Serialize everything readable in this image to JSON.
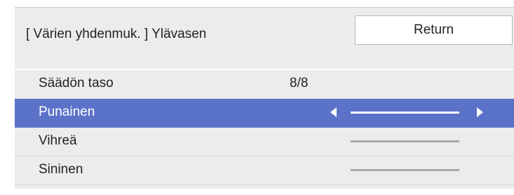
{
  "header": {
    "title": "[ Värien yhdenmuk. ] Ylävasen",
    "return_label": "Return"
  },
  "rows": [
    {
      "label": "Säädön taso",
      "value": "8/8"
    },
    {
      "label": "Punainen",
      "selected": true
    },
    {
      "label": "Vihreä"
    },
    {
      "label": "Sininen"
    }
  ],
  "colors": {
    "panel_bg": "#ececec",
    "selected_bg": "#5b72c9",
    "slider_track": "#a9a9a9"
  },
  "icons": [
    "arrow-left-icon",
    "arrow-right-icon"
  ]
}
